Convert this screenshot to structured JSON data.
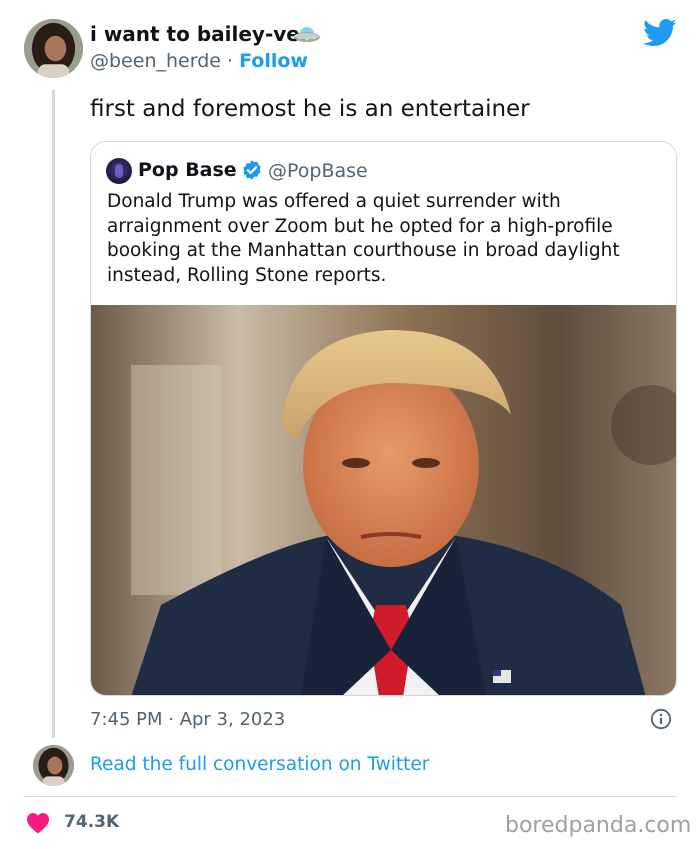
{
  "author": {
    "display_name": "i want to bailey-ve",
    "name_emoji_icon": "ufo-icon",
    "handle": "@been_herde",
    "separator": "·",
    "follow_label": "Follow"
  },
  "platform_icon": "twitter-bird-icon",
  "tweet": {
    "text": "first and foremost he is an entertainer",
    "timestamp": "7:45 PM · Apr 3, 2023"
  },
  "quoted": {
    "name": "Pop Base",
    "verified_icon": "verified-badge-icon",
    "handle": "@PopBase",
    "text": "Donald Trump was offered a quiet surrender with arraignment over Zoom but he opted for a high-profile booking at the Manhattan courthouse in broad daylight instead, Rolling Stone reports."
  },
  "read_full_link": "Read the full conversation on Twitter",
  "likes": {
    "icon": "heart-icon",
    "count": "74.3K"
  },
  "watermark": "boredpanda.com",
  "colors": {
    "link_blue": "#1d9bf0",
    "heart_pink": "#f91880",
    "secondary_text": "#536471",
    "border": "#cfd9de"
  }
}
